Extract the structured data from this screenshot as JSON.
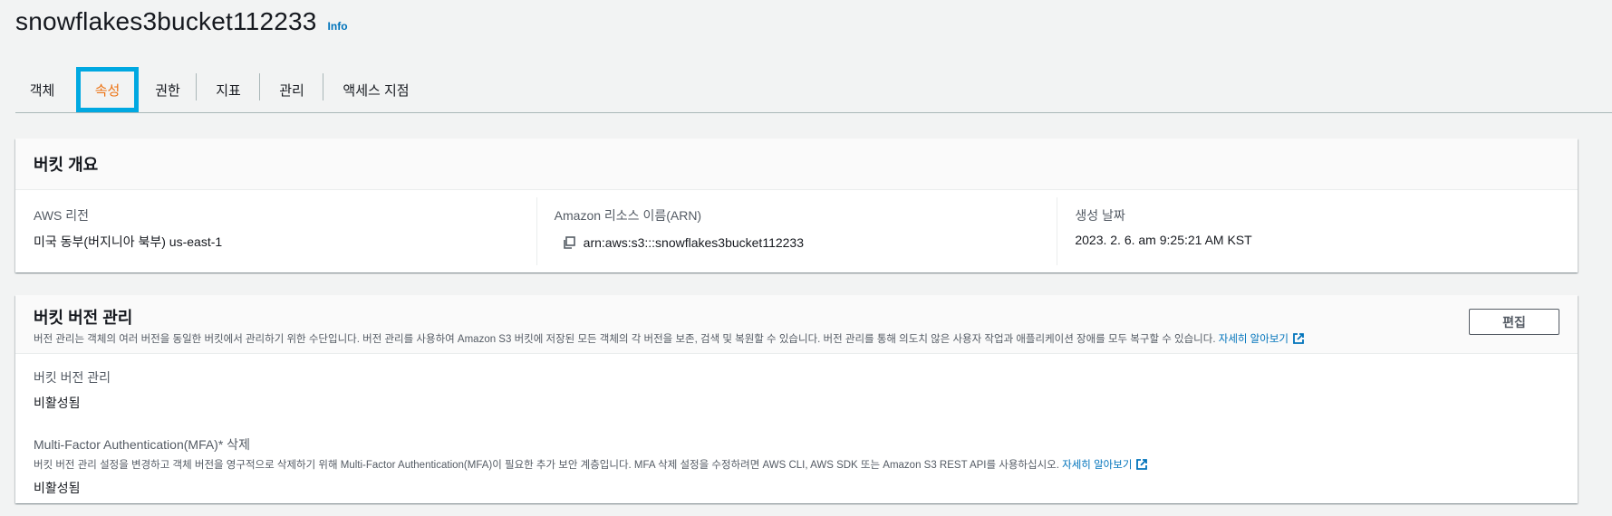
{
  "header": {
    "title": "snowflakes3bucket112233",
    "info_label": "Info"
  },
  "tabs": [
    {
      "label": "객체"
    },
    {
      "label": "속성",
      "active": true
    },
    {
      "label": "권한"
    },
    {
      "label": "지표"
    },
    {
      "label": "관리"
    },
    {
      "label": "액세스 지점"
    }
  ],
  "overview": {
    "title": "버킷 개요",
    "region_label": "AWS 리전",
    "region_value": "미국 동부(버지니아 북부) us-east-1",
    "arn_label": "Amazon 리소스 이름(ARN)",
    "arn_value": "arn:aws:s3:::snowflakes3bucket112233",
    "created_label": "생성 날짜",
    "created_value": "2023. 2. 6. am 9:25:21 AM KST"
  },
  "versioning": {
    "title": "버킷 버전 관리",
    "description": "버전 관리는 객체의 여러 버전을 동일한 버킷에서 관리하기 위한 수단입니다. 버전 관리를 사용하여 Amazon S3 버킷에 저장된 모든 객체의 각 버전을 보존, 검색 및 복원할 수 있습니다. 버전 관리를 통해 의도치 않은 사용자 작업과 애플리케이션 장애를 모두 복구할 수 있습니다.",
    "learn_more": "자세히 알아보기",
    "edit_label": "편집",
    "status_label": "버킷 버전 관리",
    "status_value": "비활성됨",
    "mfa_label": "Multi-Factor Authentication(MFA)* 삭제",
    "mfa_description": "버킷 버전 관리 설정을 변경하고 객체 버전을 영구적으로 삭제하기 위해 Multi-Factor Authentication(MFA)이 필요한 추가 보안 계층입니다. MFA 삭제 설정을 수정하려면 AWS CLI, AWS SDK 또는 Amazon S3 REST API를 사용하십시오.",
    "mfa_learn_more": "자세히 알아보기",
    "mfa_value": "비활성됨"
  },
  "colors": {
    "accent": "#ec7211",
    "link": "#0073bb",
    "highlight": "#00a8e1"
  },
  "icons": {
    "copy": "copy-icon",
    "external": "external-link-icon"
  }
}
